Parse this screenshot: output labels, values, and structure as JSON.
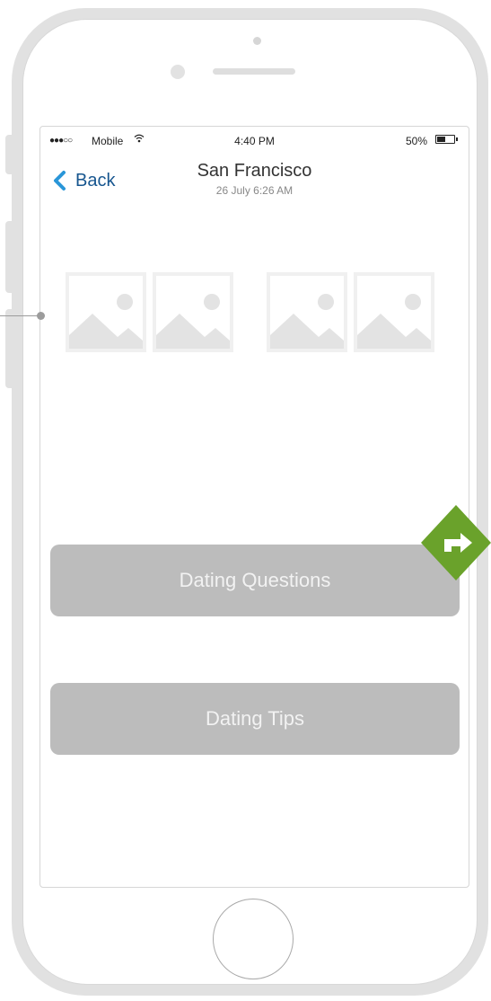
{
  "status_bar": {
    "signal": "●●●○○",
    "carrier": "Mobile",
    "wifi_glyph": "ᯤ",
    "time": "4:40 PM",
    "battery_percent": "50%",
    "battery_level": 0.5
  },
  "nav": {
    "back_label": "Back",
    "title": "San Francisco",
    "subtitle": "26 July 6:26 AM"
  },
  "images": [
    {
      "icon": "image-placeholder-icon"
    },
    {
      "icon": "image-placeholder-icon"
    },
    {
      "icon": "image-placeholder-icon"
    },
    {
      "icon": "image-placeholder-icon"
    }
  ],
  "buttons": {
    "questions_label": "Dating Questions",
    "tips_label": "Dating Tips"
  },
  "colors": {
    "accent": "#1a6fbf",
    "button_bg": "#bcbcbc",
    "diamond": "#6aa22b"
  }
}
